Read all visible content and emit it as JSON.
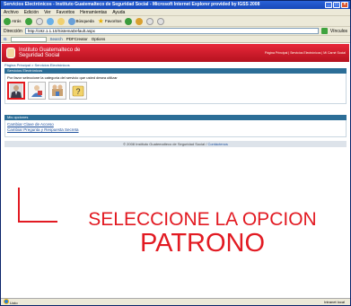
{
  "window": {
    "title": "Servicios Electrónicos - Instituto Guatemalteco de Seguridad Social - Microsoft Internet Explorer provided by IGSS 2008"
  },
  "menu": [
    "Archivo",
    "Edición",
    "Ver",
    "Favoritos",
    "Herramientas",
    "Ayuda"
  ],
  "toolbar": {
    "back": "Atrás",
    "search": "Búsqueda",
    "favorites": "Favoritos"
  },
  "address": {
    "label": "Dirección",
    "value": "http://192.1.1.10/SistemaDefault.aspx",
    "go": "Vínculos"
  },
  "linkbar": {
    "search_btn": "Search",
    "pdf": "PDFCreator",
    "options": "Options"
  },
  "site": {
    "name_line1": "Instituto Guatemalteco de",
    "name_line2": "Seguridad Social",
    "header_links": "Página Principal | Servicios Electrónicos | Mi Carné Social"
  },
  "breadcrumb": "Página Principal > Servicios Electrónicos",
  "services": {
    "title": "Servicios Electrónicos",
    "instruction": "Por favor seleccione la categoría del servicio que usted desea utilizar",
    "icons": [
      {
        "name": "patrono-icon"
      },
      {
        "name": "afiliado-icon"
      },
      {
        "name": "proveedor-icon"
      },
      {
        "name": "ayuda-icon"
      }
    ]
  },
  "options": {
    "title": "Mis opciones",
    "links": [
      "Cambiar Clave de Acceso",
      "Cambiar Pregunta y Respuesta Secreta"
    ]
  },
  "footer": {
    "text": "© 2008 Instituto Guatemalteco de Seguridad Social /",
    "link": "Contáctenos"
  },
  "overlay": {
    "line1": "SELECCIONE LA OPCION",
    "line2": "PATRONO"
  },
  "status": {
    "left": "Listo",
    "right": "Intranet local"
  },
  "colors": {
    "overlay": "#e21a22",
    "header": "#c8182a",
    "section": "#2c6e97"
  }
}
